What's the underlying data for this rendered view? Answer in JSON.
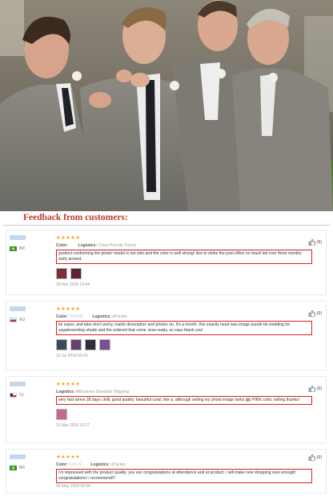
{
  "section_title": "Feedback from customers:",
  "colors": {
    "title": "#c0392b",
    "stars": "#f5a623",
    "highlight": "#d81e1e"
  },
  "hero": {
    "icon": "groomsmen-photo"
  },
  "reviews": [
    {
      "country": "BR",
      "stars": "★★★★★",
      "color_label": "Color:",
      "color_value": "",
      "logistics_label": "Logistics:",
      "logistics_value": "China Post Air Parcel",
      "text": "product conforming the photo! model is not slim and the color is well strong! due to strike the post office no brazil led over three months early arrived.",
      "date": "28 Mar 2018 14:44",
      "helpful": "(0)",
      "thumbs": [
        "#7a2f3a",
        "#5b2430"
      ]
    },
    {
      "country": "RU",
      "stars": "★★★★★",
      "color_label": "Color:",
      "color_value": "Tie0038",
      "logistics_label": "Logistics:",
      "logistics_value": "ePacket",
      "text": "tie super, and take don't worry, match description and photos on, it's a month. this exactly need was image purple tie wedding for supplementing shade and the ordered that come. bow ready, so says thank you!",
      "date": "10 Jul 2018 05:43",
      "helpful": "(0)",
      "thumbs": [
        "#3b4a5c",
        "#6a3f6e",
        "#2c2f3a",
        "#7b4f8f"
      ]
    },
    {
      "country": "CL",
      "stars": "★★★★★",
      "color_label": "",
      "color_value": "",
      "logistics_label": "Logistics:",
      "logistics_value": "AliExpress Standard Shipping",
      "text": "very fast arrive 28 days chilli. good quality. beautiful coral. like a. although selling my photo image looks jijiji PINK color. selling thanks!",
      "date": "31 Mar 2018 12:27",
      "helpful": "(0)",
      "thumbs": [
        "#c46a8c"
      ]
    },
    {
      "country": "BR",
      "stars": "★★★★★",
      "color_label": "Color:",
      "color_value": "10PCS",
      "logistics_label": "Logistics:",
      "logistics_value": "ePacket",
      "text": "i'm impressed with the product quality. you are congratulations at attendance and at product. i will make new shopping sure enough! congratulations! i recommend!!!",
      "date": "05 May 2018 05:34",
      "helpful": "(0)",
      "thumbs": []
    }
  ]
}
